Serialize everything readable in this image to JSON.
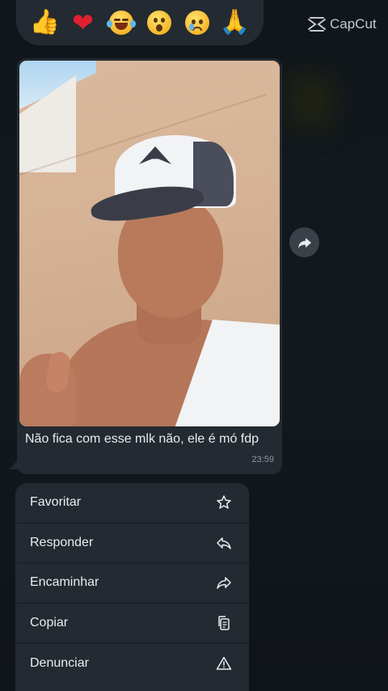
{
  "reactions": [
    {
      "name": "thumbs-up",
      "glyph": "👍"
    },
    {
      "name": "heart",
      "glyph": "❤"
    },
    {
      "name": "laughing",
      "glyph": ""
    },
    {
      "name": "surprised",
      "glyph": ""
    },
    {
      "name": "crying",
      "glyph": ""
    },
    {
      "name": "praying-hands",
      "glyph": "🙏"
    }
  ],
  "watermark": {
    "text": "CapCut"
  },
  "message": {
    "caption": "Não fica com esse mlk não, ele é mó fdp",
    "time": "23:59"
  },
  "menu": {
    "items": [
      {
        "label": "Favoritar",
        "icon": "star-icon"
      },
      {
        "label": "Responder",
        "icon": "reply-icon"
      },
      {
        "label": "Encaminhar",
        "icon": "forward-icon"
      },
      {
        "label": "Copiar",
        "icon": "copy-icon"
      },
      {
        "label": "Denunciar",
        "icon": "warning-icon"
      }
    ]
  },
  "colors": {
    "background": "#0f1418",
    "bubble": "#232a31",
    "text": "#e9edef",
    "timestamp": "#8f989e"
  }
}
